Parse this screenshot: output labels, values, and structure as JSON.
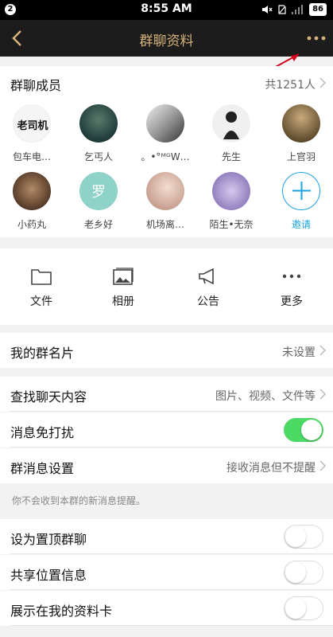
{
  "status_bar": {
    "badge": "2",
    "time": "8:55 AM",
    "battery": "86"
  },
  "nav": {
    "title": "群聊资料"
  },
  "members": {
    "label": "群聊成员",
    "count": "共1251人",
    "items": [
      {
        "name": "包车电…",
        "avatar_text": "老司机",
        "color": "#f5f5f5"
      },
      {
        "name": "乞丐人",
        "avatar_text": "",
        "color": "#1f3b3a"
      },
      {
        "name": "。•°ᴹᴳW…",
        "avatar_text": "",
        "color": "#d8d8d8"
      },
      {
        "name": "先生",
        "avatar_text": "",
        "color": "#ececec"
      },
      {
        "name": "上官羽",
        "avatar_text": "",
        "color": "#8a7a55"
      },
      {
        "name": "小药丸",
        "avatar_text": "",
        "color": "#6b4a2e"
      },
      {
        "name": "老乡好",
        "avatar_text": "罗",
        "color": "#8fd3c8"
      },
      {
        "name": "机场离…",
        "avatar_text": "",
        "color": "#e8c9b8"
      },
      {
        "name": "陌生•无奈",
        "avatar_text": "",
        "color": "#b9a8d6"
      }
    ],
    "invite_label": "邀请"
  },
  "tools": [
    {
      "label": "文件",
      "icon": "folder-icon"
    },
    {
      "label": "相册",
      "icon": "album-icon"
    },
    {
      "label": "公告",
      "icon": "megaphone-icon"
    },
    {
      "label": "更多",
      "icon": "more-icon"
    }
  ],
  "rows": {
    "nickname": {
      "label": "我的群名片",
      "value": "未设置"
    },
    "search": {
      "label": "查找聊天内容",
      "value": "图片、视频、文件等"
    },
    "dnd": {
      "label": "消息免打扰",
      "on": true
    },
    "msg_settings": {
      "label": "群消息设置",
      "value": "接收消息但不提醒"
    },
    "note": "你不会收到本群的新消息提醒。",
    "pin": {
      "label": "设为置顶群聊",
      "on": false
    },
    "location": {
      "label": "共享位置信息",
      "on": false
    },
    "profile": {
      "label": "展示在我的资料卡",
      "on": false
    }
  },
  "colors": {
    "accent": "#d5b27a",
    "toggle_on": "#4cd964",
    "invite": "#1aa3e0",
    "annotation_arrow": "#d0021b"
  }
}
